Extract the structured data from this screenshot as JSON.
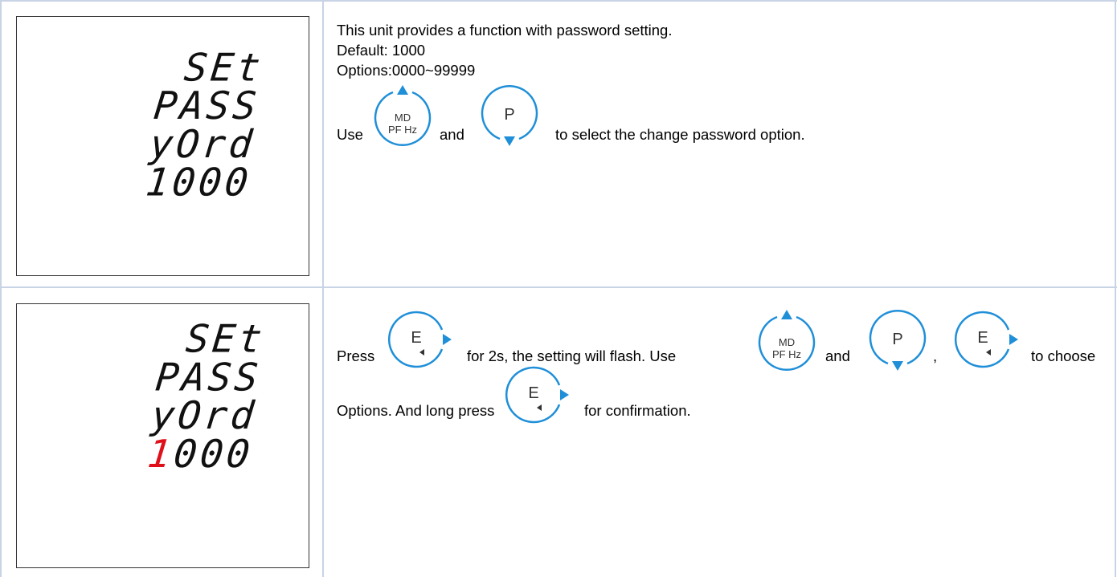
{
  "row1": {
    "lcd": {
      "line1": "SEt",
      "line2": "PASS",
      "line3": "yOrd",
      "line4": "1000"
    },
    "desc_line1": "This unit provides a function with password setting.",
    "desc_line2": "Default: 1000",
    "desc_line3": "Options:0000~99999",
    "use_word": "Use",
    "and_word": "and",
    "instruction_tail": "to select the change password option."
  },
  "row2": {
    "lcd": {
      "line1": "SEt",
      "line2": "PASS",
      "line3": "yOrd",
      "line4_highlight": "1",
      "line4_rest": "000",
      "highlight_color": "#e0101a"
    },
    "press_word": "Press",
    "mid_text": "for 2s, the setting will flash. Use",
    "and_word": "and",
    "comma": ",",
    "to_choose": "to choose",
    "line2_text": "Options.  And long press",
    "line2_tail": "for confirmation."
  },
  "buttons": {
    "md_line1": "MD",
    "md_line2": "PF Hz",
    "p_label": "P",
    "e_label": "E",
    "accent_color": "#1f8fd8"
  },
  "icons": [
    "md-pf-hz-up-button-icon",
    "p-down-button-icon",
    "e-enter-button-icon"
  ]
}
